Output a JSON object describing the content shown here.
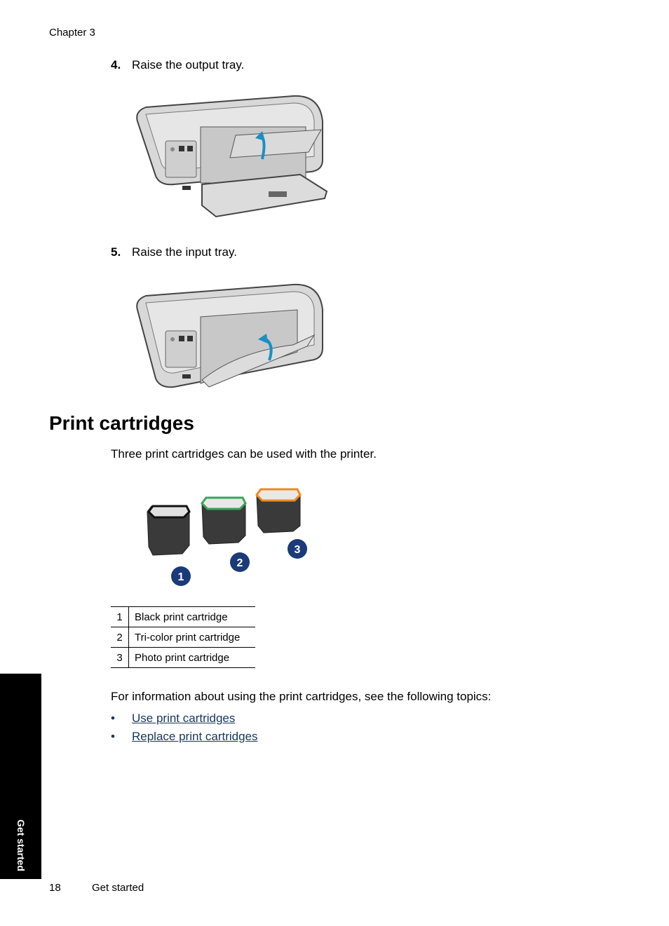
{
  "header": {
    "chapter": "Chapter 3"
  },
  "steps": [
    {
      "number": "4.",
      "text": "Raise the output tray.",
      "image": "printer-output-tray-raised-illustration"
    },
    {
      "number": "5.",
      "text": "Raise the input tray.",
      "image": "printer-input-tray-raised-illustration"
    }
  ],
  "section": {
    "title": "Print cartridges",
    "intro": "Three print cartridges can be used with the printer.",
    "image": "print-cartridges-illustration",
    "callouts": [
      "1",
      "2",
      "3"
    ],
    "legend": [
      {
        "num": "1",
        "label": "Black print cartridge"
      },
      {
        "num": "2",
        "label": "Tri-color print cartridge"
      },
      {
        "num": "3",
        "label": "Photo print cartridge"
      }
    ],
    "info": "For information about using the print cartridges, see the following topics:",
    "links": [
      {
        "bullet": "•",
        "label": "Use print cartridges"
      },
      {
        "bullet": "•",
        "label": "Replace print cartridges"
      }
    ]
  },
  "colors": {
    "link": "#17375e",
    "callout": "#1b3a7a",
    "arrow": "#1a8fc4"
  },
  "side_tab": {
    "label": "Get started"
  },
  "footer": {
    "page_number": "18",
    "title": "Get started"
  }
}
